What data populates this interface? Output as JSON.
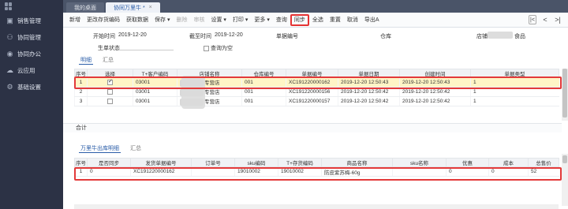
{
  "sidebar": {
    "items": [
      {
        "label": "销售管理",
        "icon": "shop-icon"
      },
      {
        "label": "协同管理",
        "icon": "users-icon"
      },
      {
        "label": "协同办公",
        "icon": "location-icon"
      },
      {
        "label": "云应用",
        "icon": "cloud-icon"
      },
      {
        "label": "基础设置",
        "icon": "gear-icon"
      }
    ]
  },
  "tabs": [
    {
      "label": "我的桌面"
    },
    {
      "label": "协同万里牛 *",
      "close": "×"
    }
  ],
  "toolbar": {
    "buttons": [
      "新增",
      "更改存货编码",
      "获取数据",
      "保存 ▾",
      "删除",
      "审核",
      "设置 ▾",
      "打印 ▾",
      "更多 ▾",
      "查询",
      "同步",
      "全选",
      "重置",
      "取消",
      "导出A"
    ],
    "disabled": [
      4,
      5
    ],
    "highlighted": 10,
    "nav": {
      "first": "|<",
      "prev": "<",
      "next": ">|"
    }
  },
  "form": {
    "start_time_label": "开始时间",
    "start_time_value": "2019-12-20",
    "end_time_label": "截至时间",
    "end_time_value": "2019-12-20",
    "doc_no_label": "单据编号",
    "warehouse_label": "仓库",
    "store_label": "店铺",
    "store_value": "食品",
    "status_label": "生单状态",
    "query_empty_label": "查询为空"
  },
  "upper_tabs": [
    "明细",
    "汇总"
  ],
  "upper_table": {
    "headers": [
      "序号",
      "选择",
      "T+客户编码",
      "店铺名称",
      "仓库编号",
      "单据编号",
      "单据日期",
      "创建时间",
      "单据类型"
    ],
    "rows": [
      {
        "no": "1",
        "checked": true,
        "cust": "03001",
        "store": "专营店",
        "wh": "001",
        "doc": "XC191220000162",
        "date": "2019-12-20 12:50:43",
        "created": "2019-12-20 12:50:43",
        "type": "1"
      },
      {
        "no": "2",
        "checked": false,
        "cust": "03001",
        "store": "专营店",
        "wh": "001",
        "doc": "XC191220000156",
        "date": "2019-12-20 12:50:42",
        "created": "2019-12-20 12:50:42",
        "type": "1"
      },
      {
        "no": "3",
        "checked": false,
        "cust": "03001",
        "store": "专营店",
        "wh": "001",
        "doc": "XC191220000157",
        "date": "2019-12-20 12:50:42",
        "created": "2019-12-20 12:50:42",
        "type": "1"
      }
    ],
    "summary_label": "合计"
  },
  "lower_tabs": [
    "万里牛出库明细",
    "汇总"
  ],
  "lower_table": {
    "headers": [
      "序号",
      "是否同步",
      "发货单据编号",
      "订单号",
      "sku编码",
      "T+存货编码",
      "商品名称",
      "sku名称",
      "优惠",
      "成本",
      "总售价"
    ],
    "rows": [
      {
        "no": "1",
        "synced": "0",
        "ship_doc": "XC191220000162",
        "order": "",
        "sku": "19010002",
        "inv": "19010002",
        "product": "防皮紫苏梅-60g",
        "sku_name": "",
        "discount": "0",
        "cost": "0",
        "total": "52"
      }
    ]
  },
  "colors": {
    "highlight": "#e33a3a",
    "sidebar": "#2c3245",
    "accent": "#2a5da8",
    "selected_row": "#fff5c6"
  }
}
